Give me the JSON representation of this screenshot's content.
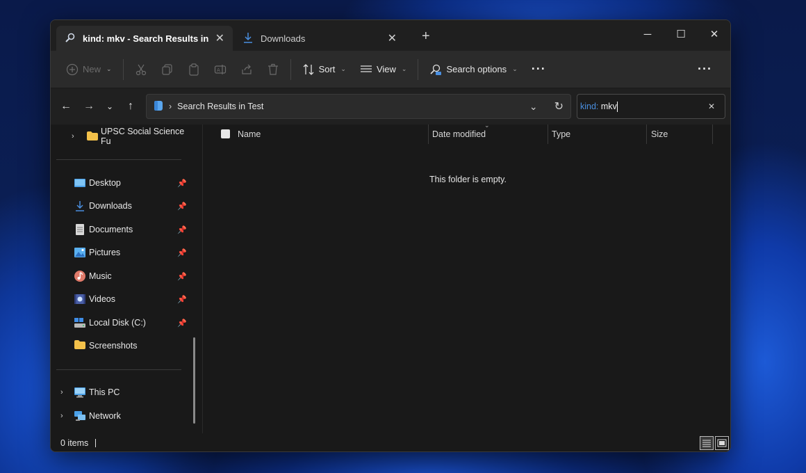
{
  "tabs": [
    {
      "title": "kind: mkv - Search Results in",
      "active": true,
      "icon": "search-icon"
    },
    {
      "title": "Downloads",
      "active": false,
      "icon": "download-icon"
    }
  ],
  "window_controls": {
    "minimize": "─",
    "maximize": "☐",
    "close": "✕"
  },
  "commandbar": {
    "new_label": "New",
    "sort_label": "Sort",
    "view_label": "View",
    "search_options_label": "Search options"
  },
  "address": {
    "path": "Search Results in Test"
  },
  "search": {
    "kind_prefix": "kind:",
    "query": " mkv"
  },
  "sidebar": {
    "top_folder": "UPSC Social Science Fu",
    "quick_access": [
      {
        "label": "Desktop",
        "icon": "desktop-icon"
      },
      {
        "label": "Downloads",
        "icon": "download-icon"
      },
      {
        "label": "Documents",
        "icon": "document-icon"
      },
      {
        "label": "Pictures",
        "icon": "pictures-icon"
      },
      {
        "label": "Music",
        "icon": "music-icon"
      },
      {
        "label": "Videos",
        "icon": "videos-icon"
      },
      {
        "label": "Local Disk (C:)",
        "icon": "drive-icon"
      },
      {
        "label": "Screenshots",
        "icon": "folder-icon"
      }
    ],
    "this_pc": "This PC",
    "network": "Network"
  },
  "columns": [
    "Name",
    "Date modified",
    "Type",
    "Size"
  ],
  "empty_message": "This folder is empty.",
  "status": {
    "items": "0 items"
  },
  "colors": {
    "accent": "#4a8fe0",
    "folder": "#f3c14a",
    "window_bg": "#191919",
    "toolbar_bg": "#2b2b2b"
  }
}
